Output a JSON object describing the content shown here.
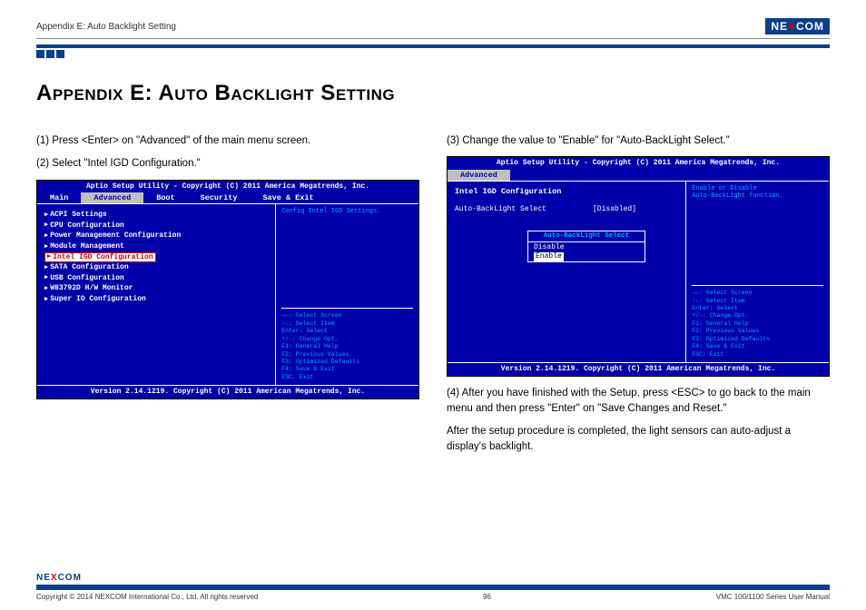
{
  "header": {
    "title": "Appendix E: Auto Backlight Setting",
    "logo_pre": "NE",
    "logo_x": "X",
    "logo_post": "COM"
  },
  "h1": "Appendix E: Auto Backlight Setting",
  "left": {
    "step1": "(1) Press <Enter> on \"Advanced\" of the main menu screen.",
    "step2": "(2) Select \"Intel IGD Configuration.\""
  },
  "right": {
    "step3": "(3) Change the value to \"Enable\" for \"Auto-BackLight Select.\"",
    "step4": "(4) After you have finished with the Setup, press <ESC> to go back to the main menu and then press \"Enter\" on \"Save Changes and Reset.\"",
    "note": "After the setup procedure is completed, the light sensors can auto-adjust a display's backlight."
  },
  "bios_common": {
    "top": "Aptio Setup Utility - Copyright (C) 2011 America Megatrends, Inc.",
    "footer": "Version 2.14.1219. Copyright (C) 2011 American Megatrends, Inc.",
    "help": "→←: Select Screen\n↑↓: Select Item\nEnter: Select\n+/-: Change Opt.\nF1: General Help\nF2: Previous Values\nF3: Optimized Defaults\nF4: Save & Exit\nESC: Exit"
  },
  "bios1": {
    "tabs": [
      "Main",
      "Advanced",
      "Boot",
      "Security",
      "Save & Exit"
    ],
    "active_tab": "Advanced",
    "items": [
      "ACPI Settings",
      "CPU Configuration",
      "Power Management Configuration",
      "Module Management",
      "Intel IGD Configuration",
      "SATA Configuration",
      "USB Configuration",
      "W83792D H/W Monitor",
      "Super IO Configuration"
    ],
    "selected_index": 4,
    "right_top": "Config Intel IGD Settings."
  },
  "bios2": {
    "tabs": [
      "Advanced"
    ],
    "section": "Intel IGD Configuration",
    "setting_label": "Auto-BackLight Select",
    "setting_value": "[Disabled]",
    "right_top": "Enable or Disable\nAuto-BackLight function.",
    "popup_title": "Auto-BackLight Select",
    "popup_opts": [
      "Disable",
      "Enable"
    ],
    "popup_selected": "Enable"
  },
  "footer": {
    "copyright": "Copyright © 2014 NEXCOM International Co., Ltd. All rights reserved",
    "page": "96",
    "manual": "VMC 100/1100 Series User Manual"
  }
}
